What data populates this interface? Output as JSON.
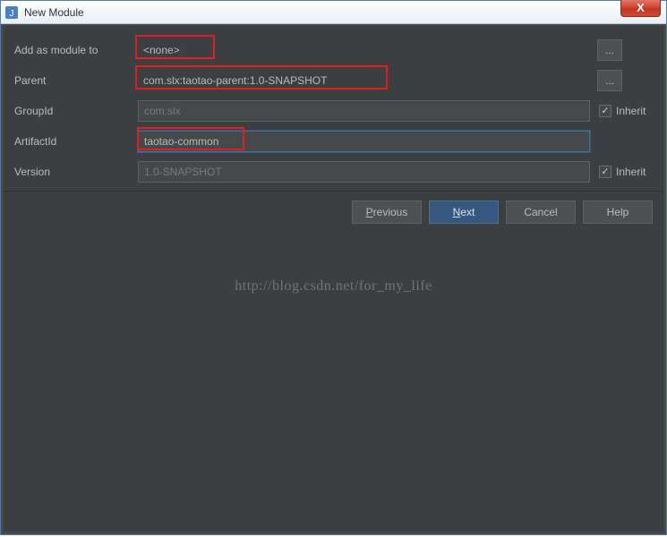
{
  "window": {
    "title": "New Module",
    "close_glyph": "X"
  },
  "form": {
    "add_as_module_label": "Add as module to",
    "add_as_module_value": "<none>",
    "parent_label": "Parent",
    "parent_value": "com.slx:taotao-parent:1.0-SNAPSHOT",
    "groupid_label": "GroupId",
    "groupid_value": "com.slx",
    "artifactid_label": "ArtifactId",
    "artifactid_value": "taotao-common",
    "version_label": "Version",
    "version_value": "1.0-SNAPSHOT",
    "inherit_label": "Inherit",
    "dots": "...",
    "check_glyph": "✓"
  },
  "watermark": "http://blog.csdn.net/for_my_life",
  "footer": {
    "previous": "Previous",
    "next": "Next",
    "cancel": "Cancel",
    "help": "Help"
  }
}
